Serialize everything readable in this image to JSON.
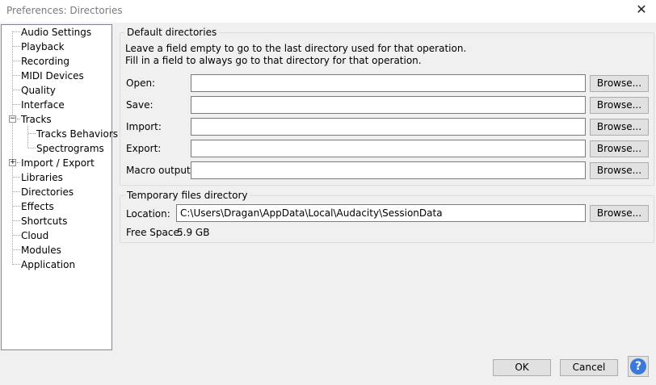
{
  "window": {
    "title": "Preferences: Directories",
    "close_glyph": "✕"
  },
  "tree": {
    "items": [
      {
        "label": "Audio Settings"
      },
      {
        "label": "Playback"
      },
      {
        "label": "Recording"
      },
      {
        "label": "MIDI Devices"
      },
      {
        "label": "Quality"
      },
      {
        "label": "Interface"
      },
      {
        "label": "Tracks"
      },
      {
        "label": "Tracks Behaviors"
      },
      {
        "label": "Spectrograms"
      },
      {
        "label": "Import / Export"
      },
      {
        "label": "Libraries"
      },
      {
        "label": "Directories"
      },
      {
        "label": "Effects"
      },
      {
        "label": "Shortcuts"
      },
      {
        "label": "Cloud"
      },
      {
        "label": "Modules"
      },
      {
        "label": "Application"
      }
    ],
    "expanded_glyph": "−",
    "collapsed_glyph": "+",
    "selected": "Directories"
  },
  "default_dirs": {
    "title": "Default directories",
    "line1": "Leave a field empty to go to the last directory used for that operation.",
    "line2": "Fill in a field to always go to that directory for that operation.",
    "rows": [
      {
        "label": "Open:",
        "value": ""
      },
      {
        "label": "Save:",
        "value": ""
      },
      {
        "label": "Import:",
        "value": ""
      },
      {
        "label": "Export:",
        "value": ""
      },
      {
        "label": "Macro output:",
        "value": ""
      }
    ],
    "browse_label": "Browse..."
  },
  "temp_dir": {
    "title": "Temporary files directory",
    "location_label": "Location:",
    "location_value": "C:\\Users\\Dragan\\AppData\\Local\\Audacity\\SessionData",
    "browse_label": "Browse...",
    "free_space_label": "Free Space:",
    "free_space_value": "5.9 GB"
  },
  "footer": {
    "ok_label": "OK",
    "cancel_label": "Cancel",
    "help_glyph": "?"
  },
  "colors": {
    "help_blue": "#3b78d8"
  }
}
